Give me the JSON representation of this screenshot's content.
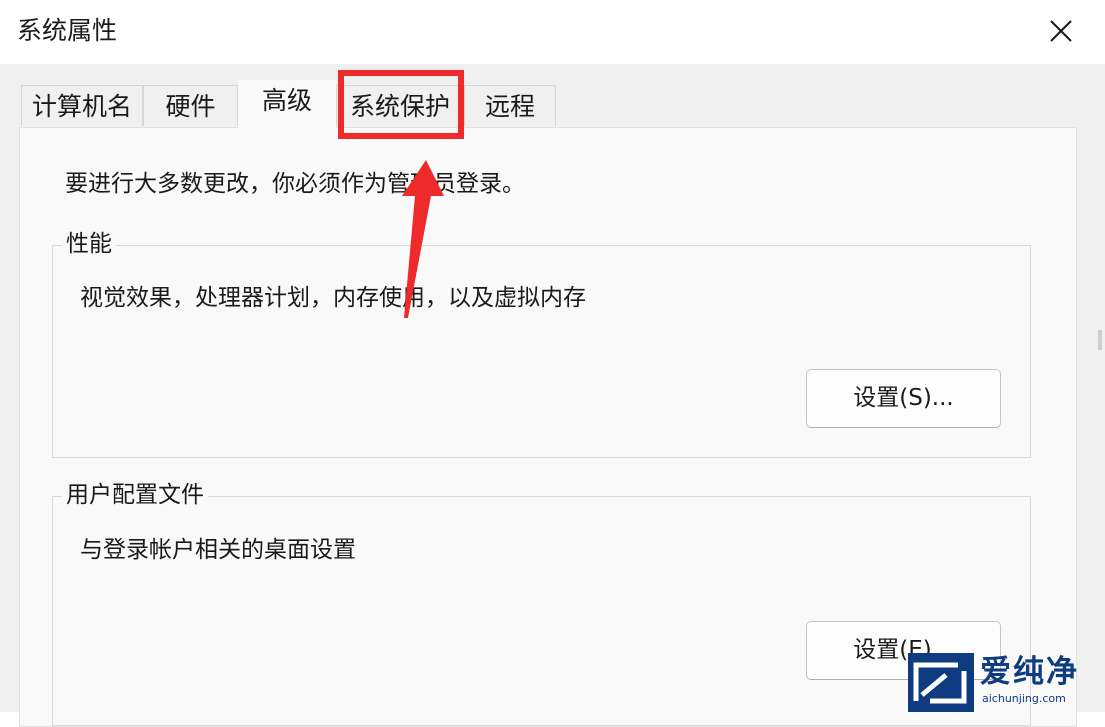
{
  "window": {
    "title": "系统属性",
    "close_icon": "close-x-icon"
  },
  "tabs": [
    {
      "label": "计算机名",
      "active": false
    },
    {
      "label": "硬件",
      "active": false
    },
    {
      "label": "高级",
      "active": true
    },
    {
      "label": "系统保护",
      "active": false,
      "highlighted": true
    },
    {
      "label": "远程",
      "active": false
    }
  ],
  "advanced": {
    "admin_note": "要进行大多数更改，你必须作为管理员登录。",
    "performance": {
      "title": "性能",
      "description": "视觉效果，处理器计划，内存使用，以及虚拟内存",
      "button_label": "设置(S)..."
    },
    "user_profiles": {
      "title": "用户配置文件",
      "description": "与登录帐户相关的桌面设置",
      "button_label": "设置(E)..."
    }
  },
  "annotation": {
    "highlight_color": "#ee2a2a",
    "arrow_icon": "red-arrow-icon"
  },
  "watermark": {
    "brand": "爱纯净",
    "url": "aichunjing.com",
    "color": "#0f3c80"
  }
}
